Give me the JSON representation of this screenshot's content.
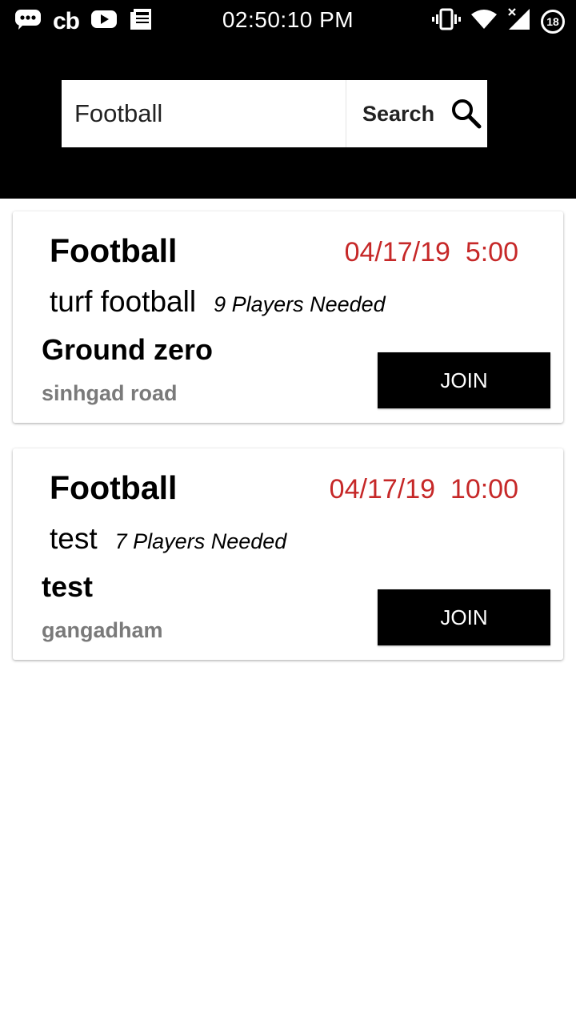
{
  "status_bar": {
    "time": "02:50:10 PM",
    "left_icons": [
      "messages-icon",
      "cb-logo",
      "youtube-icon",
      "news-icon"
    ],
    "cb_text": "cb",
    "right_icons": [
      "vibrate-icon",
      "wifi-icon",
      "signal-icon",
      "notification-badge"
    ],
    "badge_count": "18"
  },
  "search": {
    "value": "Football",
    "button_label": "Search",
    "icon": "search-icon"
  },
  "events": [
    {
      "sport": "Football",
      "datetime": "04/17/19  5:00",
      "description": "turf football",
      "players": "9 Players Needed",
      "venue": "Ground zero",
      "location": "sinhgad road",
      "join_label": "JOIN"
    },
    {
      "sport": "Football",
      "datetime": "04/17/19  10:00",
      "description": "test",
      "players": "7 Players Needed",
      "venue": "test",
      "location": "gangadham",
      "join_label": "JOIN"
    }
  ],
  "colors": {
    "header_bg": "#000000",
    "datetime": "#c62828",
    "location": "#7a7a7a",
    "join_bg": "#000000"
  }
}
